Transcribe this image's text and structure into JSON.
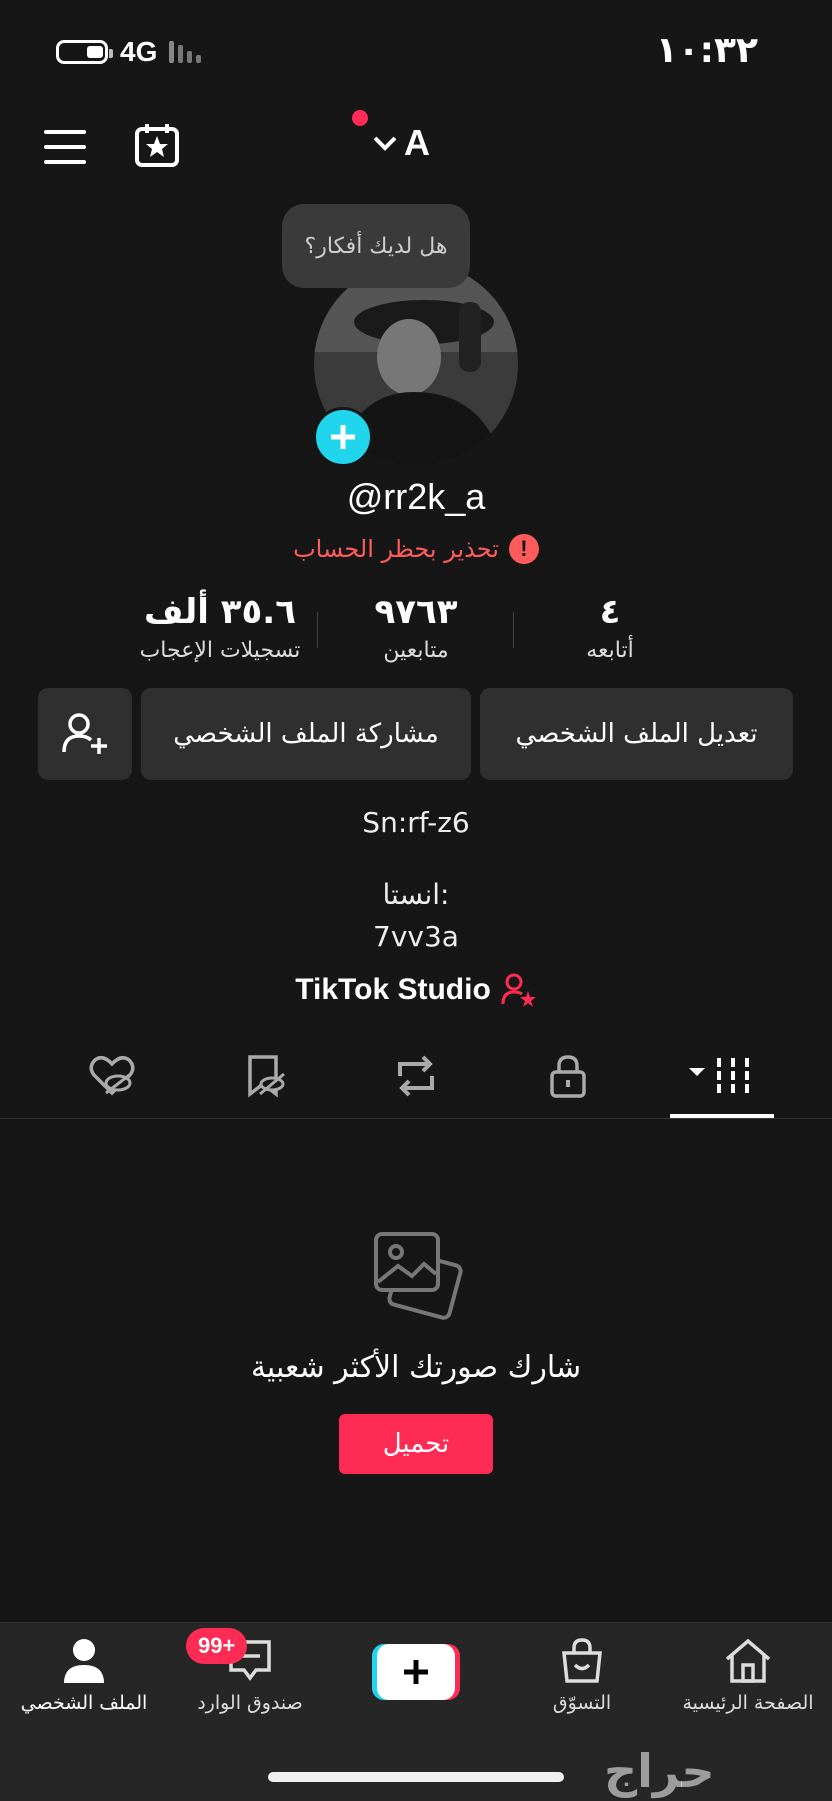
{
  "status_bar": {
    "network": "4G",
    "time": "١٠:٣٢"
  },
  "header": {
    "account_initial": "A"
  },
  "profile": {
    "prompt_bubble": "هل لديك أفكار؟",
    "username": "@rr2k_a",
    "warning": "تحذير بحظر الحساب"
  },
  "stats": [
    {
      "value": "٣٥.٦ ألف",
      "label": "تسجيلات الإعجاب"
    },
    {
      "value": "٩٧٦٣",
      "label": "متابعين"
    },
    {
      "value": "٤",
      "label": "أتابعه"
    }
  ],
  "actions": {
    "edit_profile": "تعديل الملف الشخصي",
    "share_profile": "مشاركة الملف الشخصي"
  },
  "bio": {
    "line1": "Sn:rf-z6",
    "line2": "انستا:",
    "line3": "7vv3a"
  },
  "studio_link": "TikTok Studio",
  "tabs": [
    "videos-grid-icon",
    "lock-icon",
    "repost-icon",
    "favorites-icon",
    "liked-icon"
  ],
  "empty_state": {
    "title": "شارك صورتك الأكثر شعبية",
    "button": "تحميل"
  },
  "bottom_nav": {
    "profile": "الملف الشخصي",
    "inbox": "صندوق الوارد",
    "inbox_badge": "99+",
    "shop": "التسوّق",
    "home": "الصفحة الرئيسية"
  },
  "watermark": "حراج",
  "colors": {
    "accent": "#fe2c55",
    "cyan": "#20d5ec",
    "background": "#161616"
  }
}
